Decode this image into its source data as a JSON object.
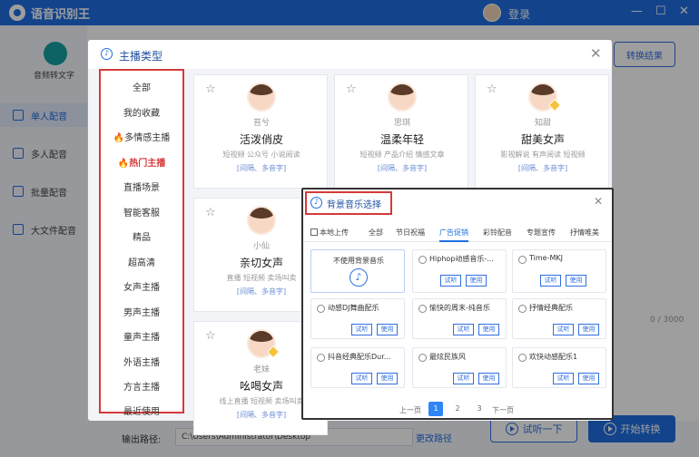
{
  "app": {
    "title": "语音识别王",
    "login": "登录",
    "win_min": "—",
    "win_max": "☐",
    "win_close": "✕"
  },
  "sidebar": {
    "logo_label": "音频转文字",
    "items": [
      {
        "label": "单人配音",
        "active": true
      },
      {
        "label": "多人配音"
      },
      {
        "label": "批量配音"
      },
      {
        "label": "大文件配音"
      }
    ]
  },
  "main": {
    "result_button": "转换结果",
    "char_count": "0 / 3000",
    "output_label": "输出路径:",
    "output_path": "C:\\Users\\Administrator\\Desktop",
    "change_path": "更改路径",
    "try_button": "试听一下",
    "start_button": "开始转换"
  },
  "anchor_dialog": {
    "title": "主播类型",
    "categories": [
      {
        "label": "全部"
      },
      {
        "label": "我的收藏"
      },
      {
        "label": "多情感主播",
        "hot": true
      },
      {
        "label": "热门主播",
        "hot": true,
        "active": true
      },
      {
        "label": "直播场景"
      },
      {
        "label": "智能客服"
      },
      {
        "label": "精品"
      },
      {
        "label": "超高清"
      },
      {
        "label": "女声主播"
      },
      {
        "label": "男声主播"
      },
      {
        "label": "童声主播"
      },
      {
        "label": "外语主播"
      },
      {
        "label": "方言主播"
      },
      {
        "label": "最近使用"
      }
    ],
    "voices": [
      {
        "name": "苔兮",
        "style": "活泼俏皮",
        "tags": "短视频  公众号  小说阅读",
        "features": "[间隔、多音字]"
      },
      {
        "name": "思琪",
        "style": "温柔年轻",
        "tags": "短视频  产品介绍  情感文章",
        "features": "[间隔、多音字]"
      },
      {
        "name": "知甜",
        "style": "甜美女声",
        "tags": "影视解说  有声阅读  短视频",
        "features": "[间隔、多音字]"
      },
      {
        "name": "小仙",
        "style": "亲切女声",
        "tags": "直播  短视频  卖场叫卖",
        "features": "[间隔、多音字]"
      },
      {
        "name": "老妹",
        "style": "吆喝女声",
        "tags": "线上直播  短视频  卖场叫卖",
        "features": "[间隔、多音字]"
      }
    ]
  },
  "music_dialog": {
    "title": "背景音乐选择",
    "tabs": [
      {
        "label": "本地上传"
      },
      {
        "label": "全部"
      },
      {
        "label": "节日祝福"
      },
      {
        "label": "广告促销",
        "active": true
      },
      {
        "label": "彩铃配音"
      },
      {
        "label": "专题宣传"
      },
      {
        "label": "抒情唯美"
      }
    ],
    "no_music": "不使用背景音乐",
    "tracks": [
      {
        "name": "Hiphop动感音乐-..."
      },
      {
        "name": "Time-MKJ"
      },
      {
        "name": "动感DJ舞曲配乐"
      },
      {
        "name": "愉快的周末-纯音乐"
      },
      {
        "name": "抒情经典配乐"
      },
      {
        "name": "抖音经典配乐Dur..."
      },
      {
        "name": "最炫民族风"
      },
      {
        "name": "欢快动感配乐1"
      }
    ],
    "listen_label": "试听",
    "use_label": "使用",
    "pagination": {
      "prev": "上一页",
      "pages": [
        "1",
        "2",
        "3"
      ],
      "current": "1",
      "next": "下一页"
    }
  }
}
